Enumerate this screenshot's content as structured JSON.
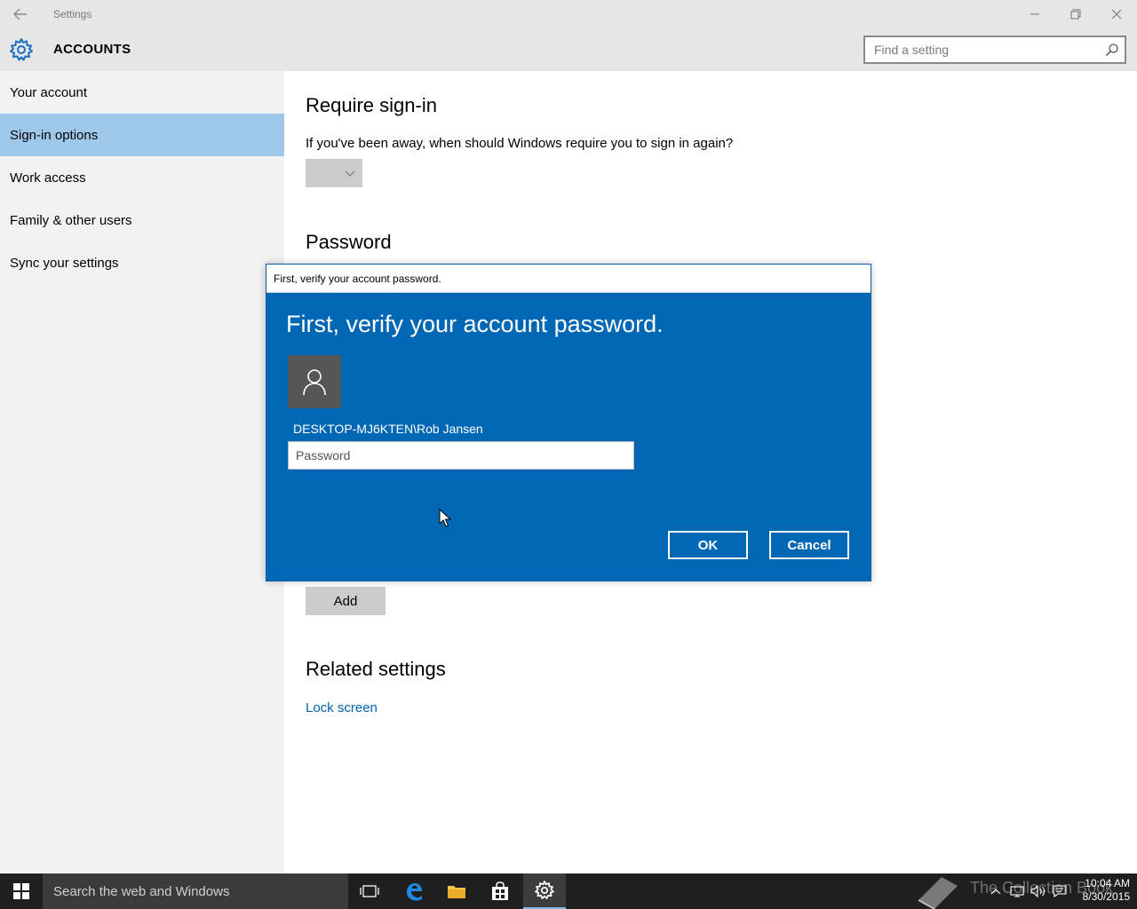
{
  "window": {
    "title": "Settings"
  },
  "header": {
    "section": "ACCOUNTS",
    "search_placeholder": "Find a setting"
  },
  "sidebar": {
    "items": [
      {
        "label": "Your account"
      },
      {
        "label": "Sign-in options",
        "active": true
      },
      {
        "label": "Work access"
      },
      {
        "label": "Family & other users"
      },
      {
        "label": "Sync your settings"
      }
    ]
  },
  "main": {
    "require_signin_heading": "Require sign-in",
    "require_signin_question": "If you've been away, when should Windows require you to sign in again?",
    "require_signin_value": "",
    "password_heading": "Password",
    "add_button": "Add",
    "related_heading": "Related settings",
    "lock_screen_link": "Lock screen"
  },
  "dialog": {
    "title": "First, verify your account password.",
    "heading": "First, verify your account password.",
    "username": "DESKTOP-MJ6KTEN\\Rob Jansen",
    "password_placeholder": "Password",
    "password_value": "",
    "ok_label": "OK",
    "cancel_label": "Cancel",
    "accent": "#0067b4"
  },
  "taskbar": {
    "search_placeholder": "Search the web and Windows",
    "icons": [
      "windows-start-icon",
      "task-view-icon",
      "edge-icon",
      "file-explorer-icon",
      "store-icon",
      "settings-icon"
    ],
    "watermark": "The Collection Book",
    "time": "10:04 AM",
    "date": "8/30/2015"
  }
}
